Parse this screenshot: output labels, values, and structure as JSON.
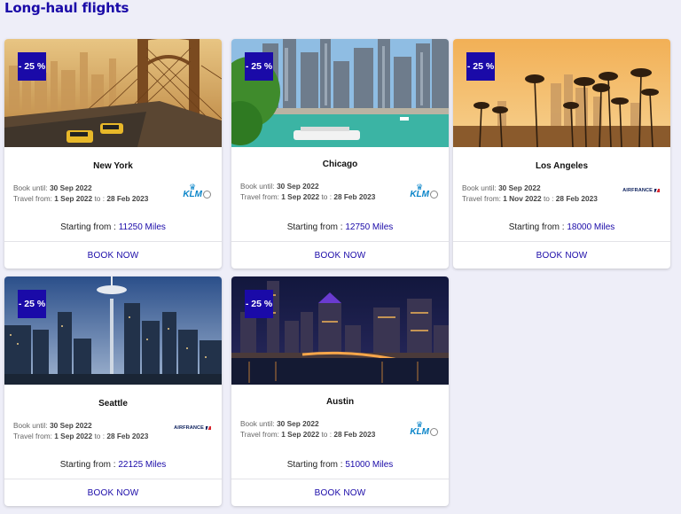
{
  "page": {
    "title": "Long-haul flights"
  },
  "colors": {
    "accent": "#1a0aa8",
    "background": "#eeeef8",
    "klm_blue": "#0a85c9"
  },
  "labels": {
    "book_until": "Book until:",
    "travel_from": "Travel from:",
    "to": "to :",
    "starting_from": "Starting from :",
    "book_now": "BOOK NOW"
  },
  "cards": [
    {
      "city": "New York",
      "discount": "- 25 %",
      "book_until": "30 Sep 2022",
      "travel_start": "1 Sep 2022",
      "travel_end": "28 Feb 2023",
      "price": "11250 Miles",
      "airline": "KLM",
      "image": "new-york-bridge-image"
    },
    {
      "city": "Chicago",
      "discount": "- 25 %",
      "book_until": "30 Sep 2022",
      "travel_start": "1 Sep 2022",
      "travel_end": "28 Feb 2023",
      "price": "12750 Miles",
      "airline": "KLM",
      "image": "chicago-river-image"
    },
    {
      "city": "Los Angeles",
      "discount": "- 25 %",
      "book_until": "30 Sep 2022",
      "travel_start": "1 Nov 2022",
      "travel_end": "28 Feb 2023",
      "price": "18000 Miles",
      "airline": "AIRFRANCE",
      "image": "los-angeles-palms-image"
    },
    {
      "city": "Seattle",
      "discount": "- 25 %",
      "book_until": "30 Sep 2022",
      "travel_start": "1 Sep 2022",
      "travel_end": "28 Feb 2023",
      "price": "22125 Miles",
      "airline": "AIRFRANCE",
      "image": "seattle-skyline-image"
    },
    {
      "city": "Austin",
      "discount": "- 25 %",
      "book_until": "30 Sep 2022",
      "travel_start": "1 Sep 2022",
      "travel_end": "28 Feb 2023",
      "price": "51000 Miles",
      "airline": "KLM",
      "image": "austin-night-image"
    }
  ]
}
